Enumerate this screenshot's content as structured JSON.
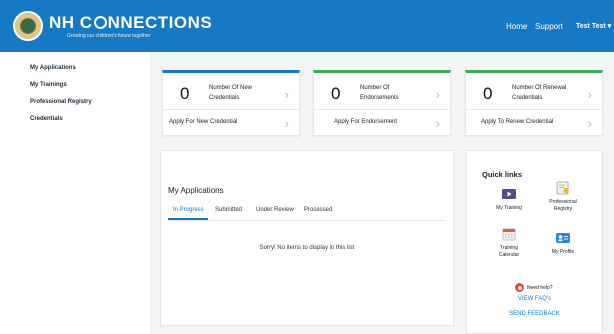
{
  "header": {
    "brand_prefix": "NH C",
    "brand_suffix": "NNECTIONS",
    "tagline": "Growing our children's future together",
    "nav": {
      "home": "Home",
      "support": "Support",
      "user": "Test Test ▾"
    },
    "accent_color": "#1779c4"
  },
  "sidebar": {
    "items": [
      {
        "label": "My Applications"
      },
      {
        "label": "My Trainings"
      },
      {
        "label": "Professional Registry"
      },
      {
        "label": "Credentials"
      }
    ]
  },
  "stat_cards": [
    {
      "count": "0",
      "label": "Number Of New Credentials",
      "action": "Apply For New Credential",
      "accent": "#1779c4"
    },
    {
      "count": "0",
      "label": "Number Of Endorsements",
      "action": "Apply For Endorsement",
      "accent": "#3cab5c"
    },
    {
      "count": "0",
      "label": "Number Of Renewal Credentials",
      "action": "Apply To Renew Credential",
      "accent": "#3cab5c"
    }
  ],
  "applications": {
    "title": "My Applications",
    "tabs": [
      "In Progress",
      "Submitted",
      "Under Review",
      "Processed"
    ],
    "active_tab": "In Progress",
    "empty_message": "Sorry! No items to display in this list"
  },
  "quick_links": {
    "title": "Quick links",
    "items": [
      {
        "label": "My Training",
        "icon": "video-icon"
      },
      {
        "label": "Professional Registry",
        "icon": "certificate-icon"
      },
      {
        "label": "Training Calendar",
        "icon": "calendar-icon"
      },
      {
        "label": "My Profile",
        "icon": "profile-card-icon"
      }
    ],
    "help_text": "Need help?",
    "faq_link": "VIEW FAQ's",
    "feedback_link": "SEND FEEDBACK"
  }
}
